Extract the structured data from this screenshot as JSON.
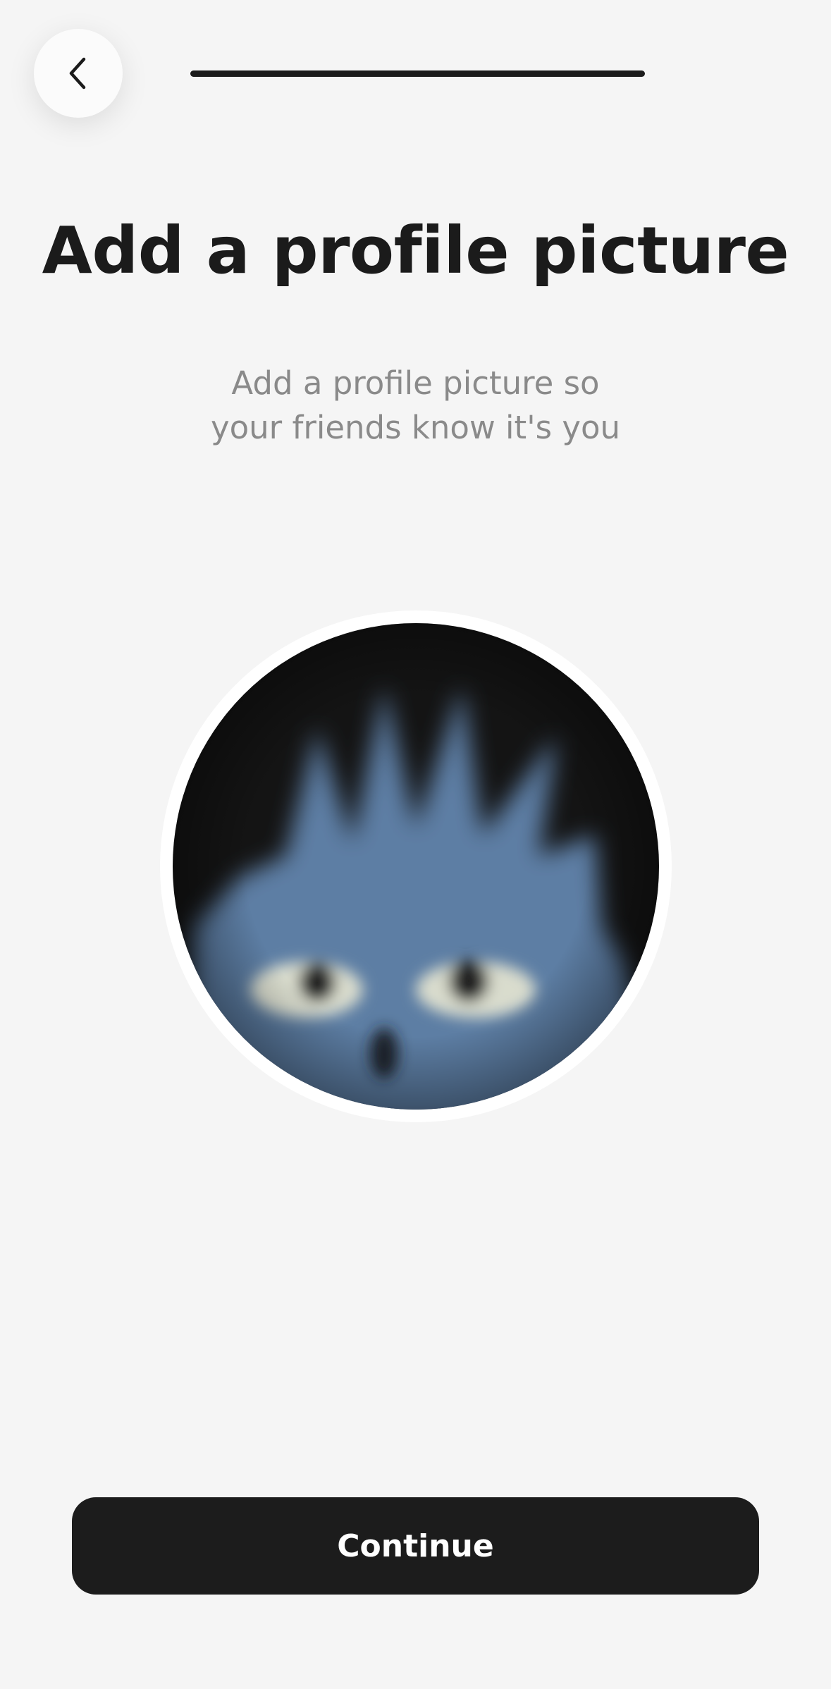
{
  "header": {
    "back_icon": "chevron-left-icon"
  },
  "title": "Add a profile picture",
  "subtitle": {
    "line1": "Add a profile picture so",
    "line2": "your friends know it's you"
  },
  "avatar": {
    "icon": "add-user-icon"
  },
  "continue_label": "Continue",
  "colors": {
    "background": "#f5f5f5",
    "button": "#1c1c1c",
    "title": "#1b1b1b",
    "subtitle": "#8a8a8a",
    "avatar_blue": "#5f7fa3"
  }
}
